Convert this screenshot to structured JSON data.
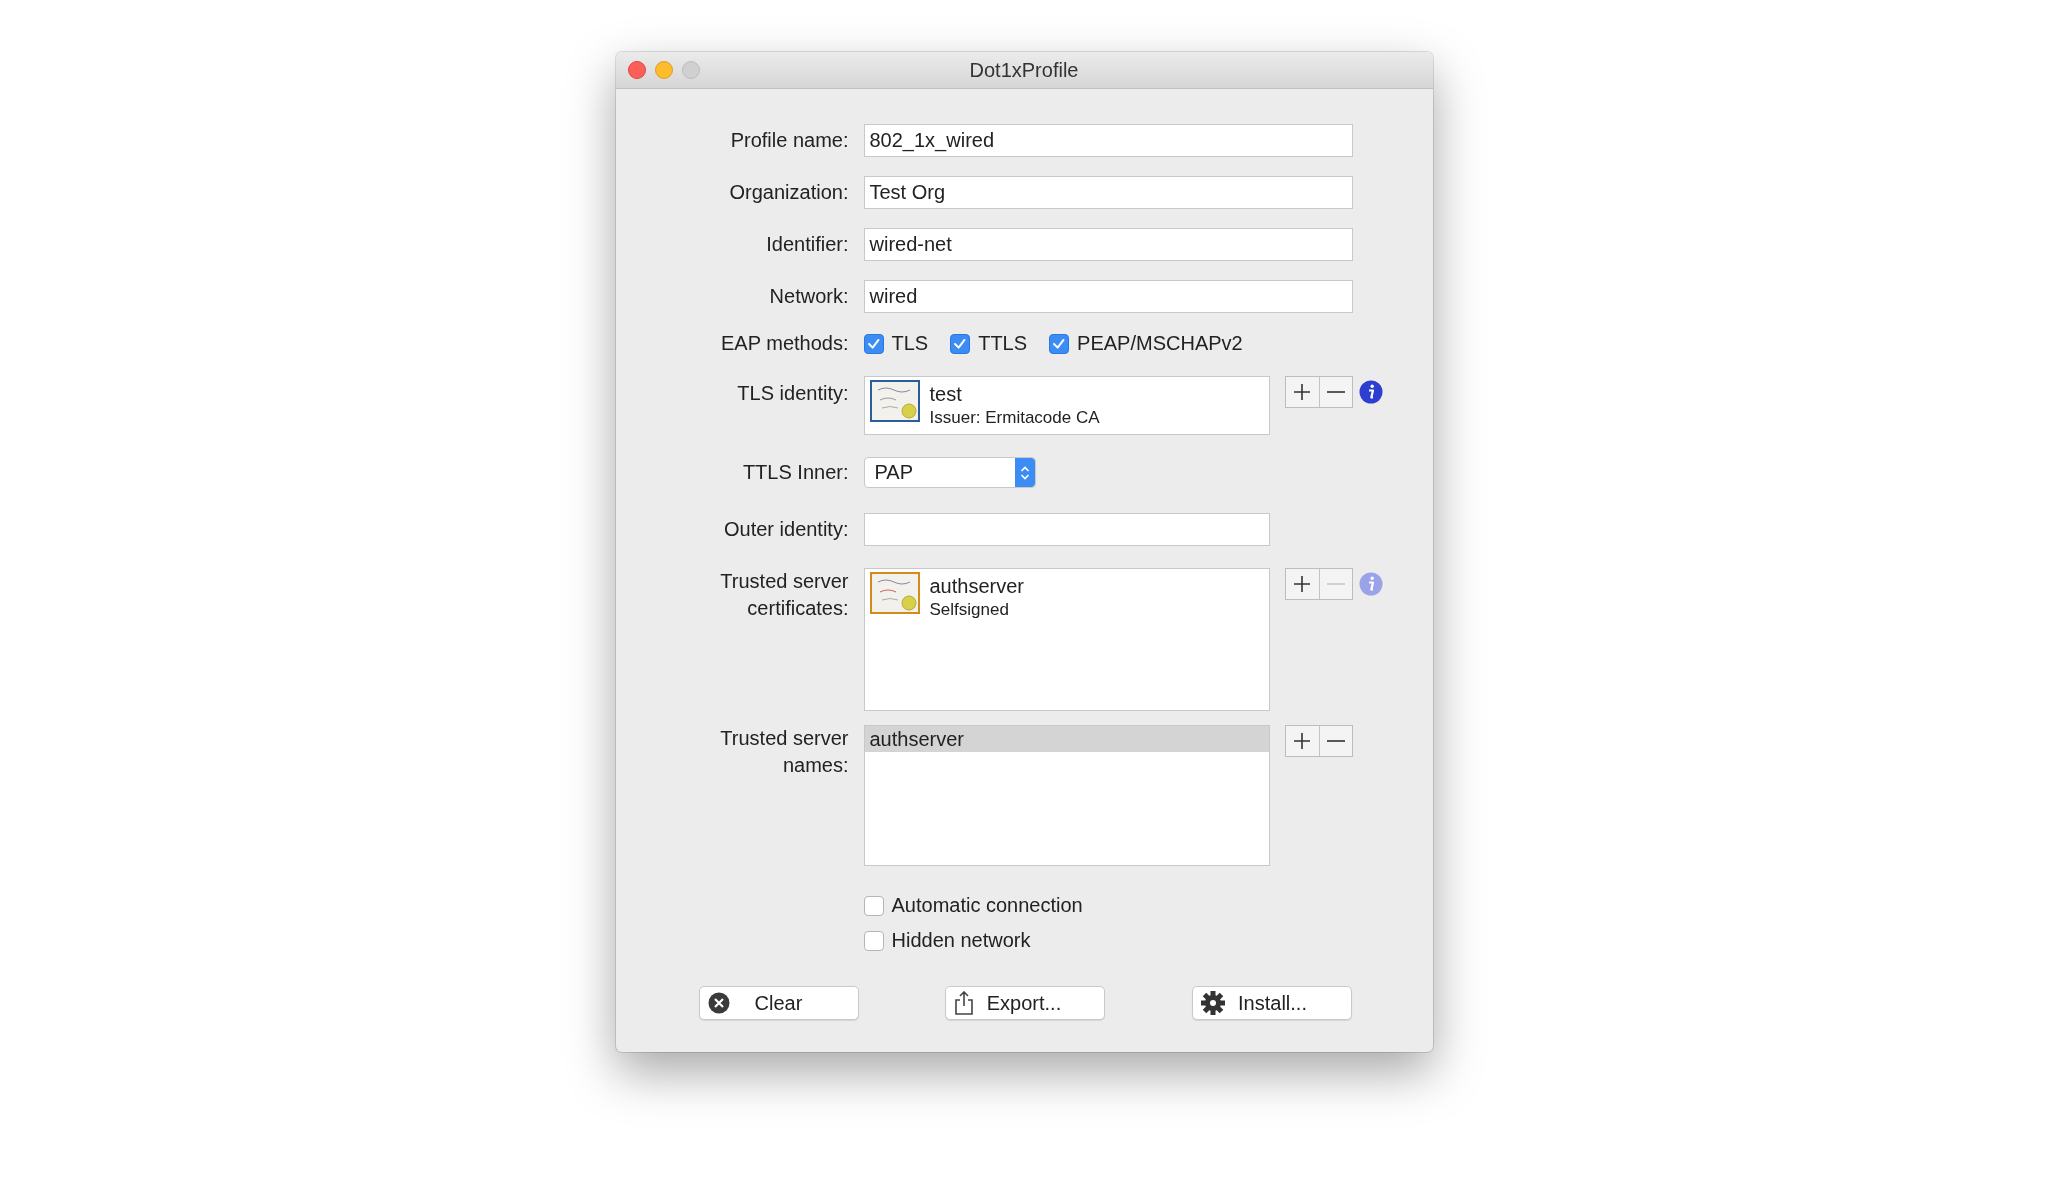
{
  "window": {
    "title": "Dot1xProfile"
  },
  "fields": [
    {
      "label": "Profile name:",
      "value": "802_1x_wired"
    },
    {
      "label": "Organization:",
      "value": "Test Org"
    },
    {
      "label": "Identifier:",
      "value": "wired-net"
    },
    {
      "label": "Network:",
      "value": "wired"
    }
  ],
  "eap_methods": {
    "label": "EAP methods:",
    "options": [
      {
        "label": "TLS",
        "checked": true
      },
      {
        "label": "TTLS",
        "checked": true
      },
      {
        "label": "PEAP/MSCHAPv2",
        "checked": true
      }
    ]
  },
  "tls_identity": {
    "label": "TLS identity:",
    "items": [
      {
        "name": "test",
        "detail": "Issuer: Ermitacode CA",
        "kind": "standard"
      }
    ],
    "remove_disabled": false,
    "info_disabled": false
  },
  "ttls_inner": {
    "label": "TTLS Inner:",
    "value": "PAP"
  },
  "outer_identity": {
    "label": "Outer identity:"
  },
  "trusted_certificates": {
    "label": "Trusted server certificates:",
    "items": [
      {
        "name": "authserver",
        "detail": "Selfsigned",
        "kind": "root"
      }
    ],
    "remove_disabled": true,
    "info_disabled": true
  },
  "trusted_names": {
    "label": "Trusted server names:",
    "items": [
      {
        "name": "authserver",
        "selected": true
      }
    ],
    "remove_disabled": false
  },
  "options": [
    {
      "label": "Automatic connection",
      "checked": false
    },
    {
      "label": "Hidden network",
      "checked": false
    }
  ],
  "buttons": [
    {
      "label": "Clear",
      "kind": "clear"
    },
    {
      "label": "Export...",
      "kind": "export"
    },
    {
      "label": "Install...",
      "kind": "install"
    }
  ]
}
